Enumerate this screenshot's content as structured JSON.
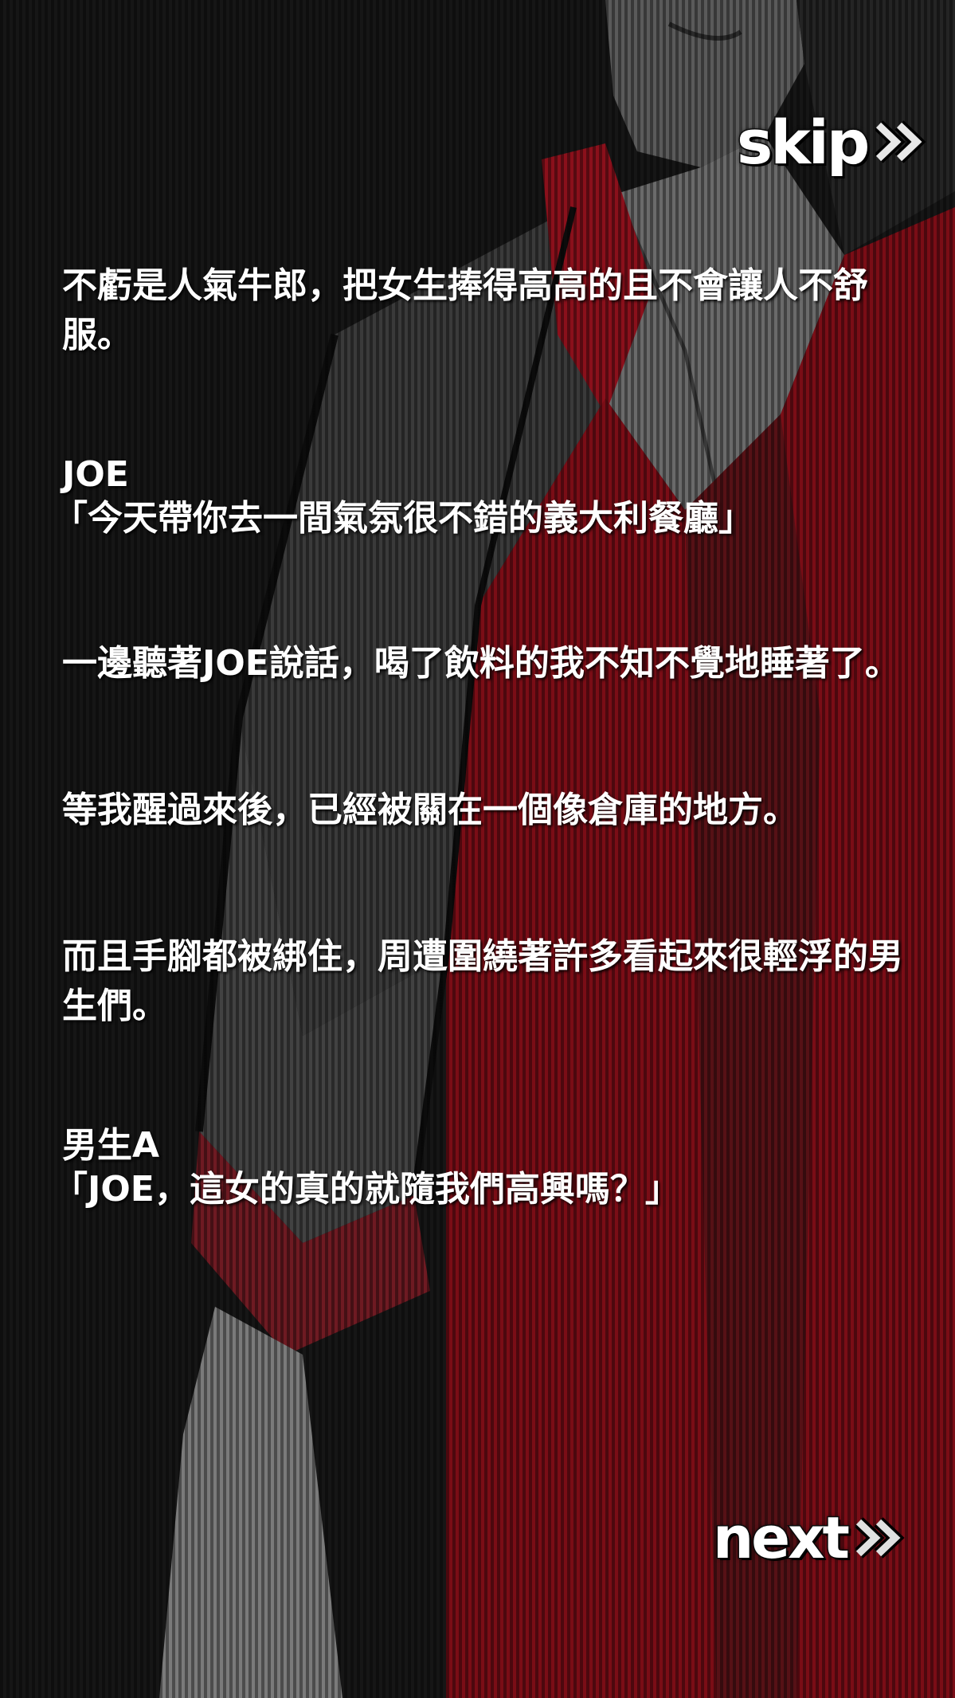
{
  "controls": {
    "skip_label": "skip",
    "next_label": "next",
    "arrow_icon": "double-chevron-right-icon"
  },
  "dialogue": {
    "narration_1": "不虧是人氣牛郎，把女生捧得高高的且不會讓人不舒服。",
    "speaker_1": "JOE",
    "speech_1": "「今天帶你去一間氣氛很不錯的義大利餐廳」",
    "narration_2": "一邊聽著JOE說話，喝了飲料的我不知不覺地睡著了。",
    "narration_3": "等我醒過來後，已經被關在一個像倉庫的地方。",
    "narration_4": "而且手腳都被綁住，周遭圍繞著許多看起來很輕浮的男生們。",
    "speaker_2": "男生A",
    "speech_2": "「JOE，這女的真的就隨我們高興嗎？」"
  },
  "colors": {
    "background": "#141414",
    "vest_red": "#7a0d16",
    "text": "#ffffff"
  }
}
